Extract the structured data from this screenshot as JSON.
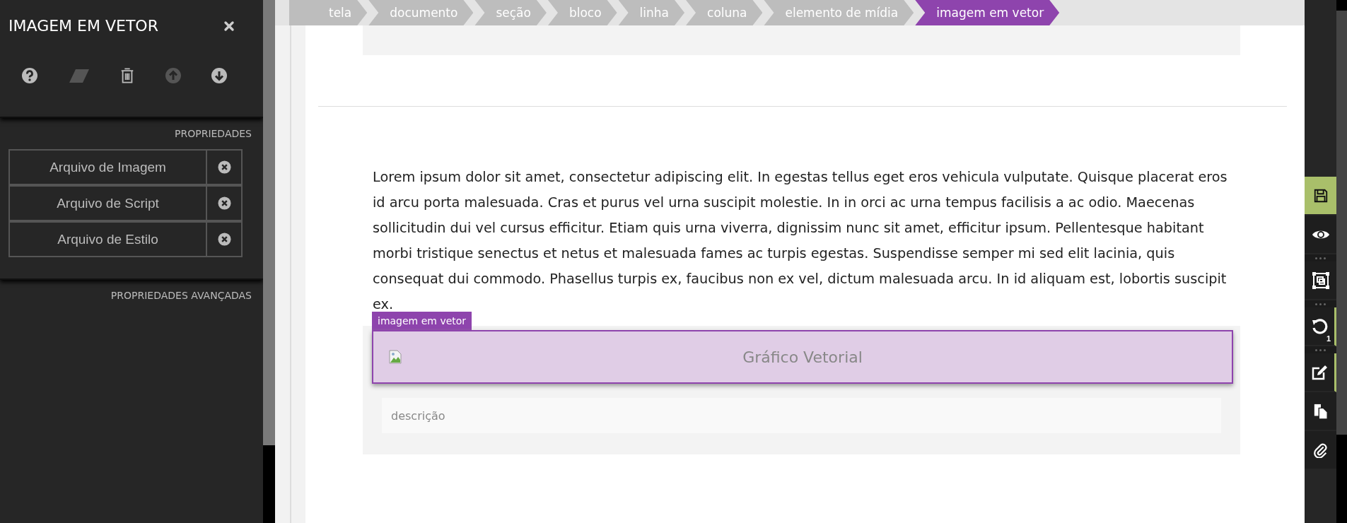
{
  "panel": {
    "title": "IMAGEM EM VETOR",
    "tools": [
      {
        "kind": "help",
        "disabled": false
      },
      {
        "kind": "eraser",
        "disabled": true
      },
      {
        "kind": "trash",
        "disabled": false
      },
      {
        "kind": "up",
        "disabled": true
      },
      {
        "kind": "down",
        "disabled": false
      }
    ],
    "properties_title": "PROPRIEDADES",
    "properties": [
      {
        "label": "Arquivo de Imagem"
      },
      {
        "label": "Arquivo de Script"
      },
      {
        "label": "Arquivo de Estilo"
      }
    ],
    "advanced_title": "PROPRIEDADES AVANÇADAS"
  },
  "breadcrumb": [
    {
      "label": "tela",
      "selected": false
    },
    {
      "label": "documento",
      "selected": false
    },
    {
      "label": "seção",
      "selected": false
    },
    {
      "label": "bloco",
      "selected": false
    },
    {
      "label": "linha",
      "selected": false
    },
    {
      "label": "coluna",
      "selected": false
    },
    {
      "label": "elemento de mídia",
      "selected": false
    },
    {
      "label": "imagem em vetor",
      "selected": true
    }
  ],
  "content": {
    "paragraph": "Lorem ipsum dolor sit amet, consectetur adipiscing elit. In egestas tellus eget eros vehicula vulputate. Quisque placerat eros id arcu porta malesuada. Cras et purus vel urna suscipit molestie. In in orci ac urna tempus facilisis a ac odio. Maecenas sollicitudin dui vel cursus efficitur. Etiam quis urna viverra, dignissim nunc sit amet, efficitur ipsum. Pellentesque habitant morbi tristique senectus et netus et malesuada fames ac turpis egestas. Suspendisse semper mi sed elit lacinia, quis consequat dui commodo. Phasellus turpis ex, faucibus non ex vel, dictum malesuada arcu. In id aliquam est, lobortis suscipit ex.",
    "element_tag": "imagem em vetor",
    "image_alt": "Gráfico Vetorial",
    "description_placeholder": "descrição"
  },
  "right_toolbar": [
    {
      "kind": "save",
      "highlighted": true,
      "marked": false
    },
    {
      "kind": "preview",
      "highlighted": false,
      "marked": false
    },
    {
      "kind": "frame",
      "highlighted": false,
      "marked": false
    },
    {
      "kind": "undo",
      "highlighted": false,
      "marked": true,
      "badge": "1"
    },
    {
      "kind": "edit",
      "highlighted": false,
      "marked": true
    },
    {
      "kind": "copy",
      "highlighted": false,
      "marked": false
    },
    {
      "kind": "attach",
      "highlighted": false,
      "marked": false
    }
  ]
}
